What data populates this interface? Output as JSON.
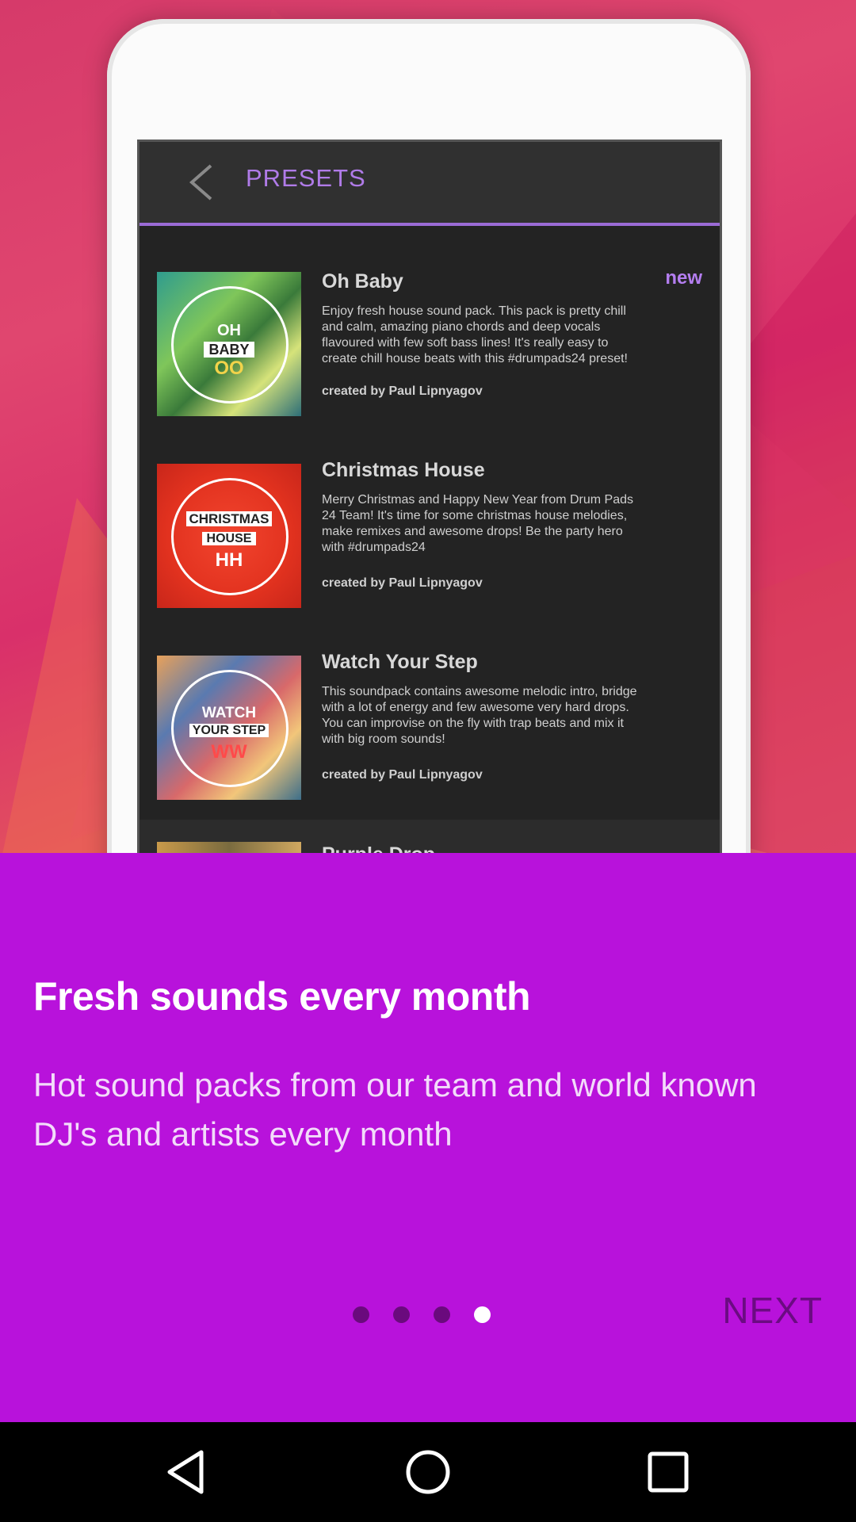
{
  "presets_screen": {
    "title": "PRESETS",
    "items": [
      {
        "name": "Oh Baby",
        "badge": "new",
        "description": "Enjoy fresh house sound pack. This pack is pretty chill and calm, amazing piano chords and deep vocals flavoured with few soft bass lines! It's really easy to create chill house beats with this #drumpads24 preset!",
        "author": "created by Paul Lipnyagov",
        "thumb_lines": [
          "OH",
          "BABY",
          "OO"
        ]
      },
      {
        "name": "Christmas House",
        "description": "Merry Christmas and Happy New Year from Drum Pads 24 Team! It's time for some christmas house melodies, make remixes and awesome drops! Be the party hero with #drumpads24",
        "author": "created by Paul Lipnyagov",
        "thumb_lines": [
          "CHRISTMAS",
          "HOUSE",
          "HH"
        ]
      },
      {
        "name": "Watch Your Step",
        "description": "This soundpack contains awesome melodic intro, bridge with a lot of energy and few awesome very hard drops. You can improvise on the fly with trap beats and mix it with big room sounds!",
        "author": "created by Paul Lipnyagov",
        "thumb_lines": [
          "WATCH",
          "YOUR STEP",
          "WW"
        ]
      },
      {
        "name": "Purple Drop"
      }
    ]
  },
  "onboarding": {
    "title": "Fresh sounds every month",
    "subtitle": "Hot sound packs from our team and world known DJ's and artists every month",
    "pages_total": 4,
    "active_page": 4,
    "next_label": "NEXT"
  },
  "colors": {
    "panel_bg": "#b812db",
    "accent_purple": "#b07be8",
    "dot_inactive": "#6a0a7d",
    "dot_active": "#ffffff"
  },
  "navbar": {
    "icons": [
      "back-triangle-icon",
      "home-circle-icon",
      "recent-square-icon"
    ]
  }
}
